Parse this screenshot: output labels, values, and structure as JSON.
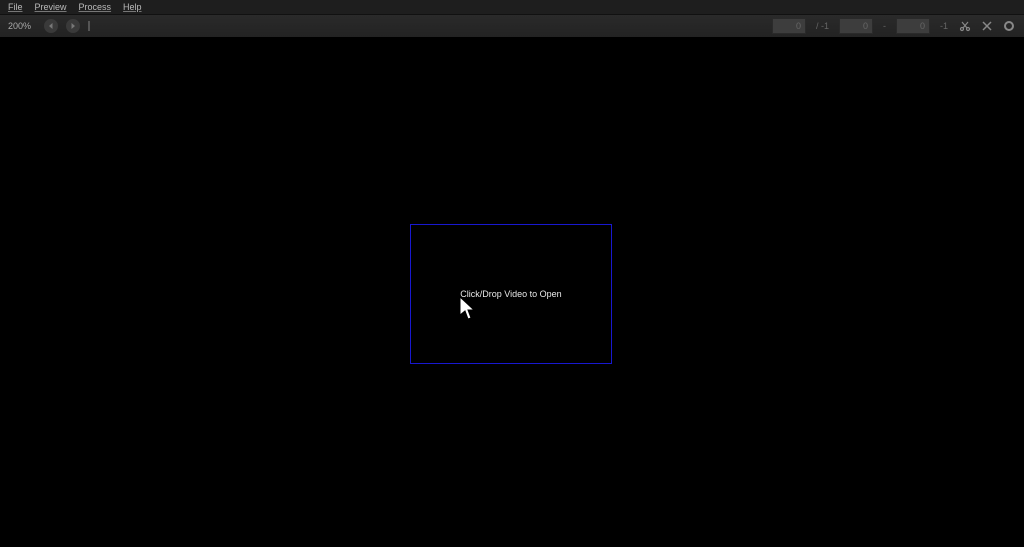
{
  "menu": {
    "file": "File",
    "preview": "Preview",
    "process": "Process",
    "help": "Help"
  },
  "toolbar": {
    "zoom": "200%",
    "frame_a": "0",
    "sep1": "/ -1",
    "frame_b": "0",
    "sep2": "-",
    "frame_c": "0",
    "sep3": "-1"
  },
  "dropzone": {
    "label": "Click/Drop Video to Open"
  }
}
